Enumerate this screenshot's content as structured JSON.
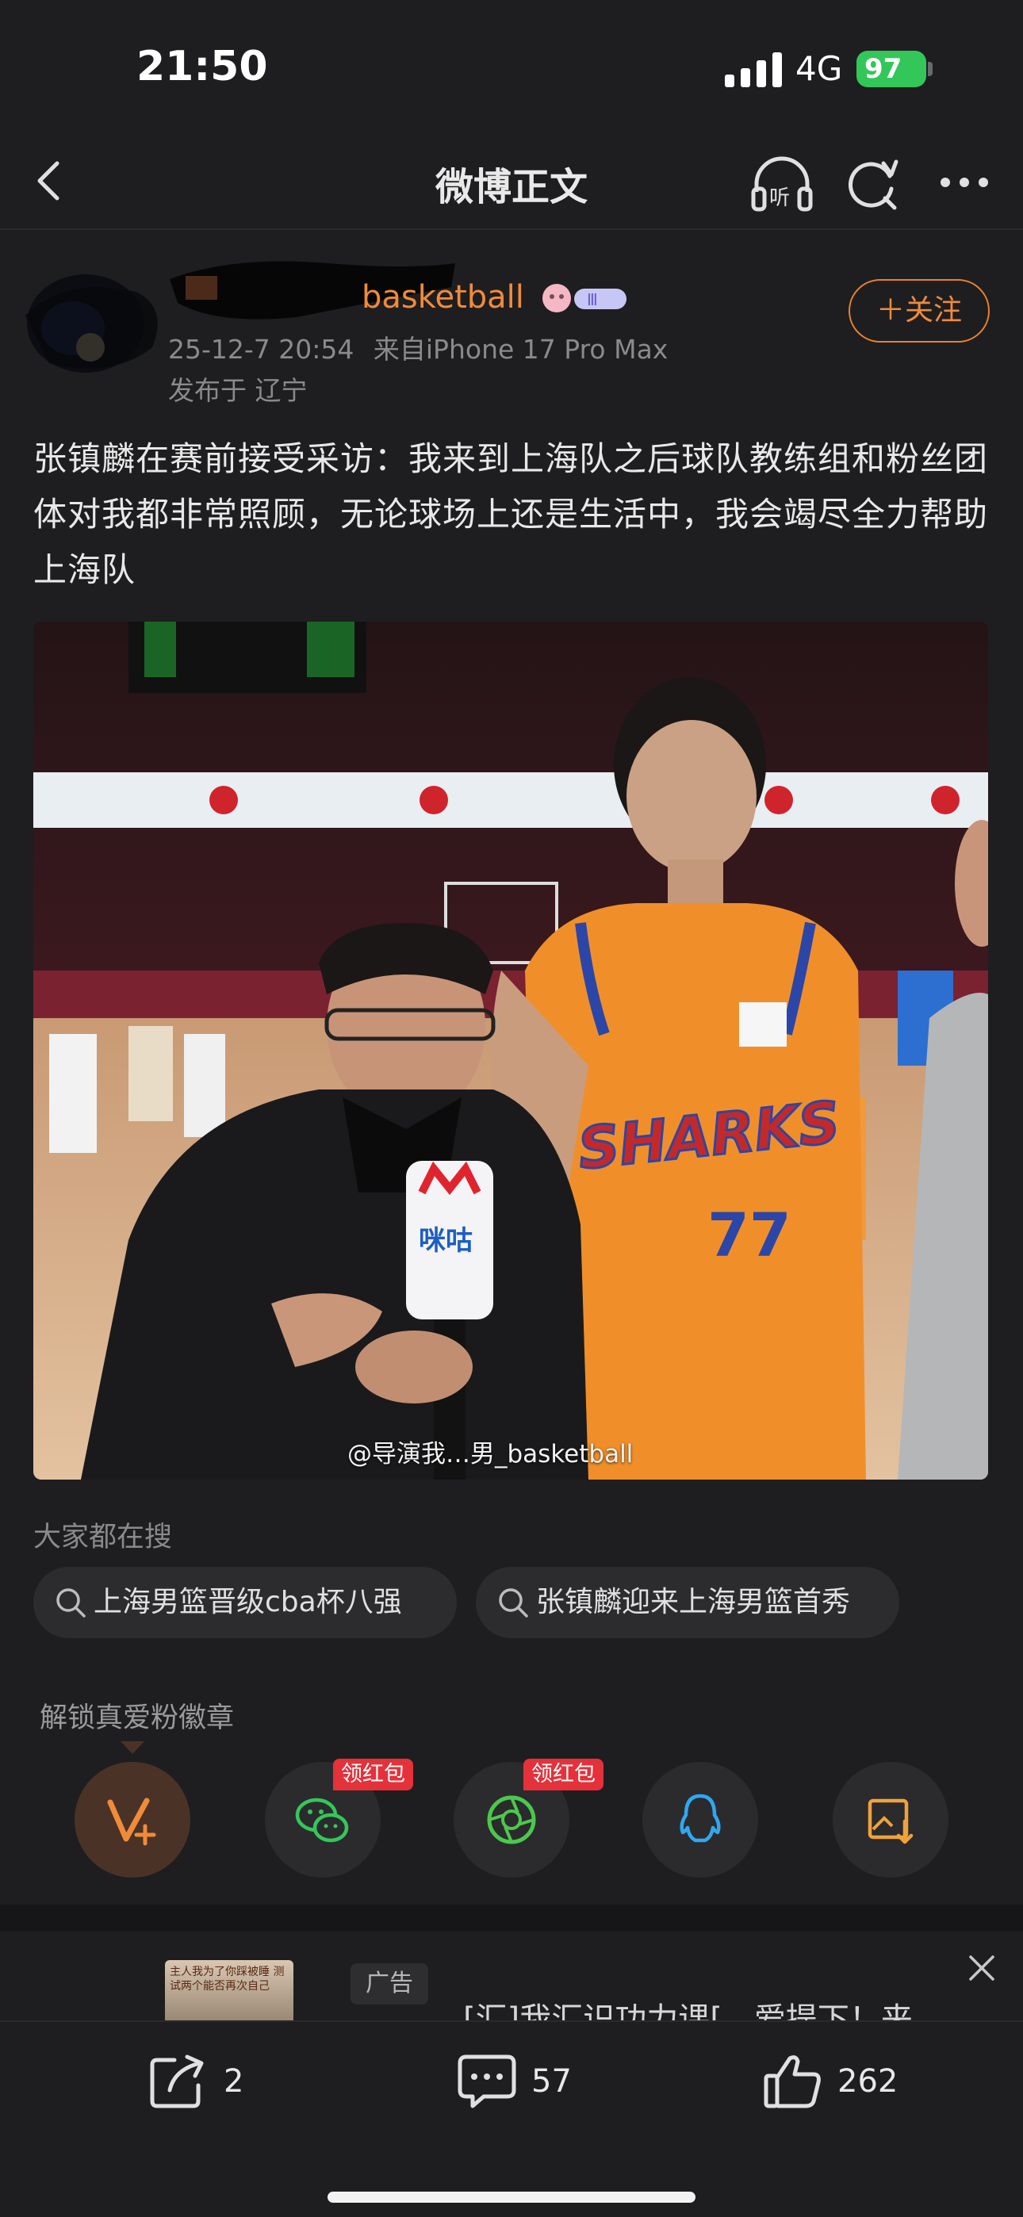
{
  "status_bar": {
    "time": "21:50",
    "network": "4G",
    "battery": "97"
  },
  "nav": {
    "title": "微博正文",
    "icons": [
      "back-icon",
      "headphones-listen-icon",
      "refresh-search-icon",
      "more-icon"
    ]
  },
  "author": {
    "name_visible": "basketball",
    "time": "25-12-7 20:54",
    "source": "来自iPhone 17 Pro Max",
    "location": "发布于 辽宁",
    "follow_label": "＋关注",
    "name_color": "#f08b3a"
  },
  "post": {
    "text": "张镇麟在赛前接受采访：我来到上海队之后球队教练组和粉丝团体对我都非常照顾，无论球场上还是生活中，我会竭尽全力帮助上海队"
  },
  "photo": {
    "watermark": "@导演我…男_basketball",
    "jersey_text": "SHARKS",
    "jersey_number": "77",
    "mic_label": "咪咕"
  },
  "searches": {
    "heading": "大家都在搜",
    "items": [
      {
        "label": "上海男篮晋级cba杯八强"
      },
      {
        "label": "张镇麟迎来上海男篮首秀"
      }
    ]
  },
  "share": {
    "heading": "解锁真爱粉徽章",
    "tags": [
      "领红包",
      "领红包"
    ],
    "buttons": [
      "vplus-icon",
      "wechat-icon",
      "moments-icon",
      "qq-icon",
      "save-image-icon"
    ]
  },
  "ad": {
    "tag": "广告",
    "title": "[汇]我汇识功力课[，爱提下！来",
    "thumb_text": "主人我为了你踩被睡 测试两个能否再次自己"
  },
  "actions": {
    "repost_count": "2",
    "comment_count": "57",
    "like_count": "262"
  },
  "colors": {
    "accent": "#f08b3a",
    "background": "#1e1e20",
    "red_tag": "#e5313a",
    "battery": "#33c759"
  }
}
